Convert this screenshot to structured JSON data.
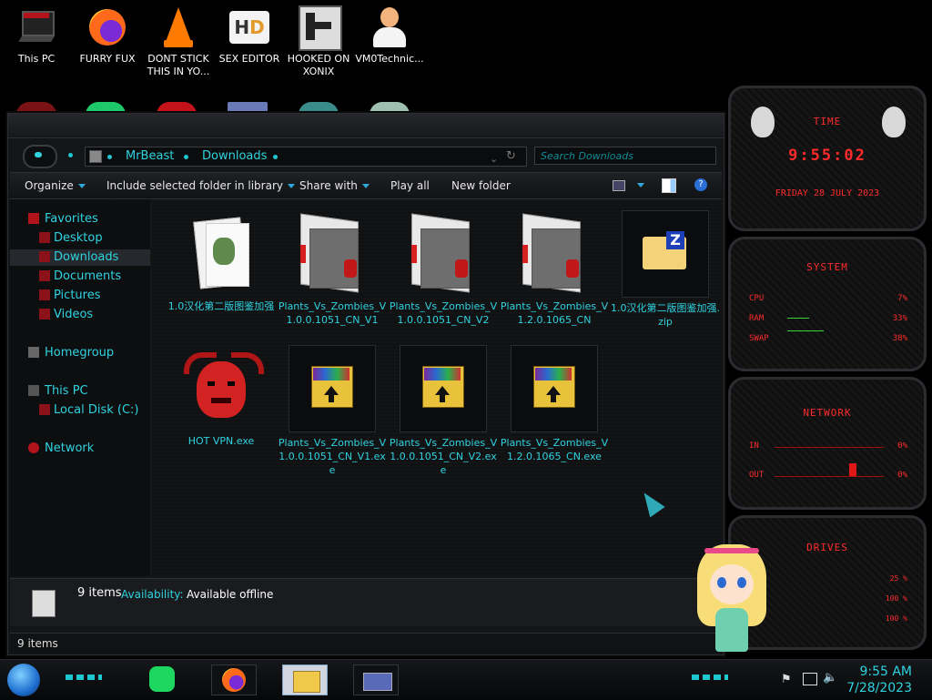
{
  "desktop": {
    "icons": [
      {
        "label": "This PC",
        "icon": "computer-icon"
      },
      {
        "label": "FURRY FUX",
        "icon": "firefox-icon"
      },
      {
        "label": "DONT STICK THIS IN YO...",
        "icon": "vlc-cone-icon"
      },
      {
        "label": "SEX EDITOR",
        "icon": "hxd-editor-icon"
      },
      {
        "label": "HOOKED ON XONIX",
        "icon": "xonix-game-icon"
      },
      {
        "label": "VM0Technic...",
        "icon": "doctor-avatar-icon"
      }
    ]
  },
  "explorer": {
    "address": {
      "root": "MrBeast",
      "folder": "Downloads"
    },
    "search_placeholder": "Search Downloads",
    "toolbar": {
      "organize": "Organize",
      "include": "Include selected folder in library",
      "share": "Share with",
      "play": "Play all",
      "new_folder": "New folder"
    },
    "nav": {
      "favorites": "Favorites",
      "desktop": "Desktop",
      "downloads": "Downloads",
      "documents": "Documents",
      "pictures": "Pictures",
      "videos": "Videos",
      "homegroup": "Homegroup",
      "this_pc": "This PC",
      "local_disk": "Local Disk (C:)",
      "network": "Network"
    },
    "files": [
      {
        "name": "1.0汉化第二版图鉴加强",
        "icon": "folder-with-files-icon"
      },
      {
        "name": "Plants_Vs_Zombies_V1.0.0.1051_CN_V1",
        "icon": "folder-icon"
      },
      {
        "name": "Plants_Vs_Zombies_V1.0.0.1051_CN_V2",
        "icon": "folder-icon"
      },
      {
        "name": "Plants_Vs_Zombies_V1.2.0.1065_CN",
        "icon": "folder-icon"
      },
      {
        "name": "1.0汉化第二版图鉴加强.zip",
        "icon": "zip-folder-icon"
      },
      {
        "name": "HOT VPN.exe",
        "icon": "red-demon-icon"
      },
      {
        "name": "Plants_Vs_Zombies_V1.0.0.1051_CN_V1.exe",
        "icon": "winrar-installer-icon"
      },
      {
        "name": "Plants_Vs_Zombies_V1.0.0.1051_CN_V2.exe",
        "icon": "winrar-installer-icon"
      },
      {
        "name": "Plants_Vs_Zombies_V1.2.0.1065_CN.exe",
        "icon": "winrar-installer-icon"
      }
    ],
    "details": {
      "count": "9 items",
      "availability_label": "Availability:",
      "availability_value": "Available offline"
    },
    "status": "9 items"
  },
  "gadgets": {
    "time": {
      "title": "TIME",
      "clock": "9:55:02",
      "date": "FRIDAY 28 JULY 2023"
    },
    "system": {
      "title": "SYSTEM",
      "rows": [
        {
          "label": "CPU",
          "value": "7%",
          "level": 0.07
        },
        {
          "label": "RAM",
          "value": "33%",
          "level": 0.33
        },
        {
          "label": "SWAP",
          "value": "38%",
          "level": 0.38
        }
      ]
    },
    "network": {
      "title": "NETWORK",
      "rows": [
        {
          "label": "IN",
          "value": "0%"
        },
        {
          "label": "OUT",
          "value": "0%"
        }
      ]
    },
    "drives": {
      "title": "DRIVES",
      "rows": [
        "25 %",
        "100 %",
        "100 %"
      ]
    }
  },
  "taskbar": {
    "time": "9:55 AM",
    "date": "7/28/2023",
    "apps": [
      "spotify-icon",
      "firefox-icon",
      "file-explorer-icon",
      "window-icon"
    ]
  },
  "colors": {
    "accent": "#2fd3e0",
    "gadget_red": "#ff2b2b",
    "background": "#000000"
  }
}
